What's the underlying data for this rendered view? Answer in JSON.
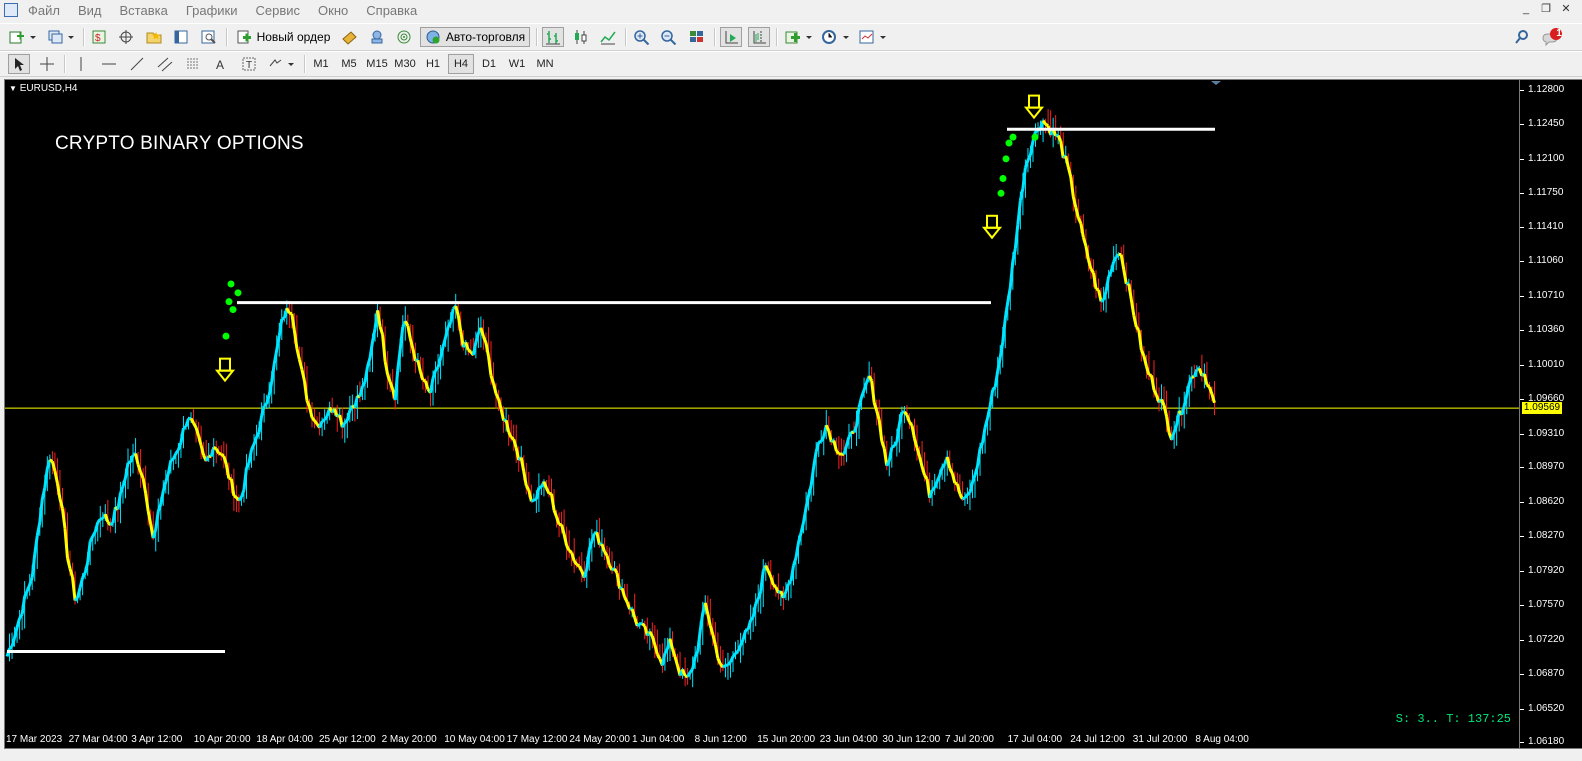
{
  "menu": [
    "Файл",
    "Вид",
    "Вставка",
    "Графики",
    "Сервис",
    "Окно",
    "Справка"
  ],
  "toolbar": {
    "new_order": "Новый ордер",
    "autotrading": "Авто-торговля"
  },
  "timeframes": [
    "M1",
    "M5",
    "M15",
    "M30",
    "H1",
    "H4",
    "D1",
    "W1",
    "MN"
  ],
  "active_timeframe": "H4",
  "notification_count": "1",
  "chart": {
    "symbol": "EURUSD,H4",
    "title": "CRYPTO BINARY OPTIONS",
    "status": "S: 3.. T: 137:25",
    "current_price": "1.09569",
    "price_labels": [
      "1.12800",
      "1.12450",
      "1.12100",
      "1.11750",
      "1.11410",
      "1.11060",
      "1.10710",
      "1.10360",
      "1.10010",
      "1.09660",
      "1.09310",
      "1.08970",
      "1.08620",
      "1.08270",
      "1.07920",
      "1.07570",
      "1.07220",
      "1.06870",
      "1.06520",
      "1.06180"
    ],
    "time_labels": [
      "17 Mar 2023",
      "27 Mar 04:00",
      "3 Apr 12:00",
      "10 Apr 20:00",
      "18 Apr 04:00",
      "25 Apr 12:00",
      "2 May 20:00",
      "10 May 04:00",
      "17 May 12:00",
      "24 May 20:00",
      "1 Jun 04:00",
      "8 Jun 12:00",
      "15 Jun 20:00",
      "23 Jun 04:00",
      "30 Jun 12:00",
      "7 Jul 20:00",
      "17 Jul 04:00",
      "24 Jul 12:00",
      "31 Jul 20:00",
      "8 Aug 04:00"
    ],
    "colors": {
      "up": "#00e5ff",
      "down": "#ffff00",
      "wick_down": "#ff2020",
      "level": "#ffffff",
      "signal": "#00ff00",
      "current_line": "#ffff00"
    },
    "close_path": [
      1.0705,
      1.073,
      1.076,
      1.079,
      1.086,
      1.091,
      1.088,
      1.081,
      1.076,
      1.079,
      1.083,
      1.085,
      1.084,
      1.086,
      1.09,
      1.091,
      1.088,
      1.082,
      1.087,
      1.09,
      1.092,
      1.095,
      1.093,
      1.09,
      1.092,
      1.091,
      1.088,
      1.086,
      1.09,
      1.093,
      1.096,
      1.1,
      1.105,
      1.106,
      1.1,
      1.096,
      1.094,
      1.095,
      1.096,
      1.094,
      1.096,
      1.097,
      1.1,
      1.106,
      1.1,
      1.097,
      1.105,
      1.102,
      1.099,
      1.097,
      1.1,
      1.103,
      1.106,
      1.102,
      1.101,
      1.104,
      1.1,
      1.096,
      1.094,
      1.092,
      1.089,
      1.086,
      1.088,
      1.087,
      1.084,
      1.082,
      1.08,
      1.079,
      1.083,
      1.082,
      1.08,
      1.078,
      1.076,
      1.074,
      1.073,
      1.072,
      1.07,
      1.072,
      1.069,
      1.068,
      1.071,
      1.076,
      1.072,
      1.069,
      1.07,
      1.072,
      1.073,
      1.076,
      1.08,
      1.078,
      1.076,
      1.079,
      1.083,
      1.087,
      1.092,
      1.094,
      1.092,
      1.091,
      1.093,
      1.096,
      1.099,
      1.095,
      1.09,
      1.092,
      1.096,
      1.094,
      1.09,
      1.087,
      1.089,
      1.091,
      1.088,
      1.086,
      1.088,
      1.092,
      1.096,
      1.1,
      1.106,
      1.113,
      1.12,
      1.123,
      1.125,
      1.124,
      1.123,
      1.12,
      1.116,
      1.112,
      1.109,
      1.106,
      1.11,
      1.112,
      1.108,
      1.104,
      1.1,
      1.098,
      1.096,
      1.093,
      1.095,
      1.098,
      1.1,
      1.099,
      1.096
    ]
  }
}
